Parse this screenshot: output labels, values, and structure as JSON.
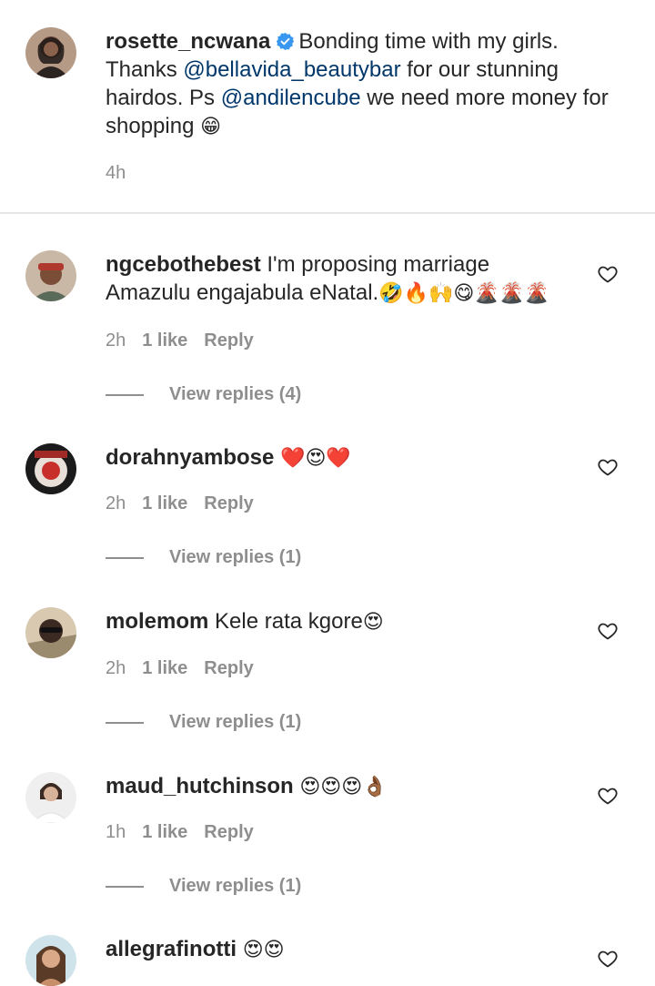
{
  "caption": {
    "username": "rosette_ncwana",
    "text_1": "Bonding time with my girls. Thanks ",
    "mention_1": "@bellavida_beautybar",
    "text_2": " for our stunning hairdos. Ps ",
    "mention_2": "@andilencube",
    "text_3": " we need more money for shopping ",
    "emoji": "😁",
    "time": "4h"
  },
  "comments": [
    {
      "username": "ngcebothebest",
      "text": "I'm proposing marriage Amazulu engajabula eNatal.",
      "emoji": "🤣🔥🙌😋🌋🌋🌋",
      "time": "2h",
      "likes": "1 like",
      "reply": "Reply",
      "view_replies": "View replies (4)"
    },
    {
      "username": "dorahnyambose",
      "text": "",
      "emoji": "❤️😍❤️",
      "time": "2h",
      "likes": "1 like",
      "reply": "Reply",
      "view_replies": "View replies (1)"
    },
    {
      "username": "molemom",
      "text": "Kele rata kgore",
      "emoji": "😍",
      "time": "2h",
      "likes": "1 like",
      "reply": "Reply",
      "view_replies": "View replies (1)"
    },
    {
      "username": "maud_hutchinson",
      "text": "",
      "emoji": "😍😍😍👌🏾",
      "time": "1h",
      "likes": "1 like",
      "reply": "Reply",
      "view_replies": "View replies (1)"
    },
    {
      "username": "allegrafinotti",
      "text": "",
      "emoji": "😍😍"
    }
  ],
  "icons": {
    "verified": "verified-badge-icon",
    "like": "heart-outline-icon"
  },
  "colors": {
    "text": "#262626",
    "secondary": "#8e8e8e",
    "mention": "#00376b",
    "verified": "#3897f0",
    "divider": "#e6e6e6"
  }
}
